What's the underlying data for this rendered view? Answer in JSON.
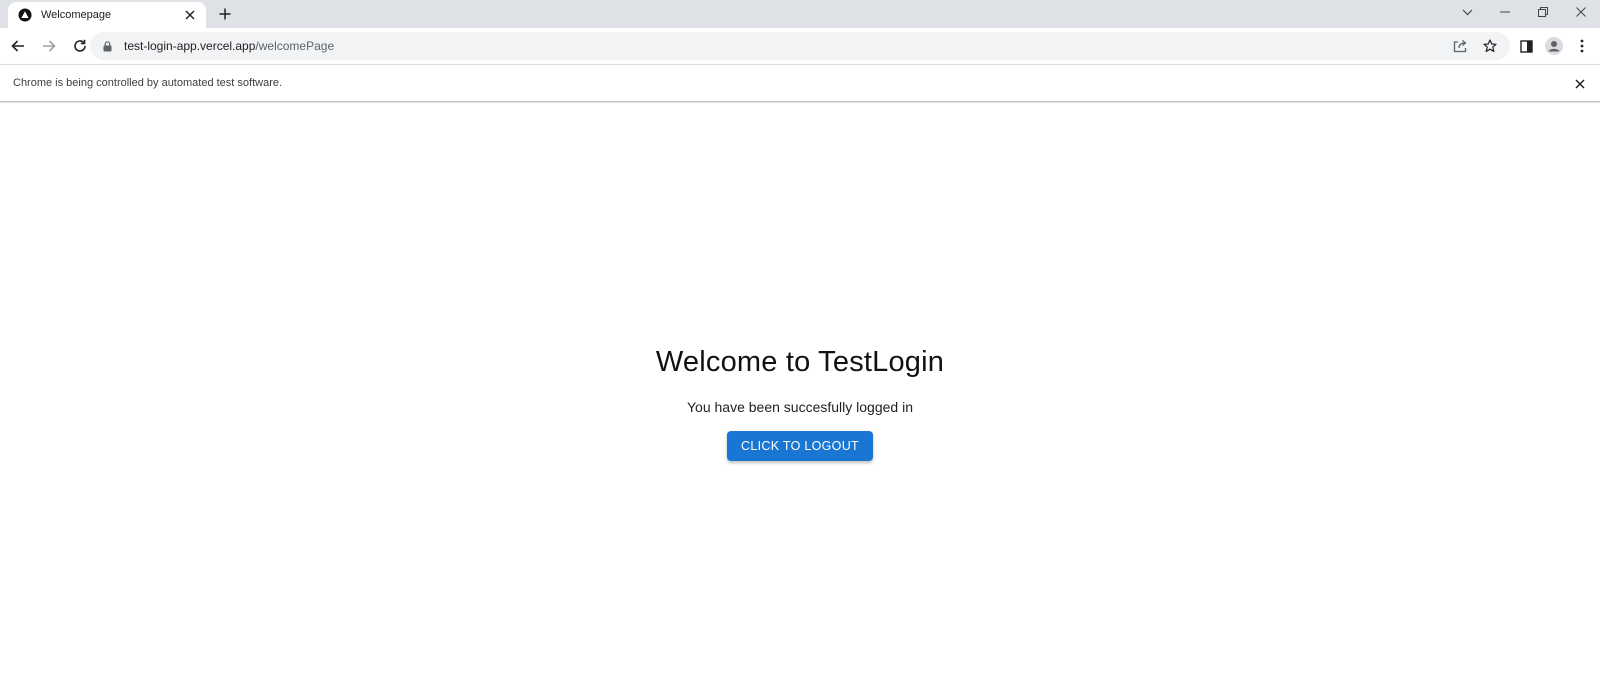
{
  "browser": {
    "tab": {
      "title": "Welcomepage",
      "favicon": "vercel-triangle-icon"
    },
    "url": {
      "host": "test-login-app.vercel.app",
      "path": "/welcomePage"
    },
    "infobar": {
      "message": "Chrome is being controlled by automated test software."
    }
  },
  "page": {
    "heading": "Welcome to TestLogin",
    "message": "You have been succesfully logged in",
    "logout_label": "CLICK TO LOGOUT"
  },
  "colors": {
    "accent": "#1976d2",
    "tabstrip": "#dee1e6",
    "omnibox": "#f1f3f4"
  }
}
